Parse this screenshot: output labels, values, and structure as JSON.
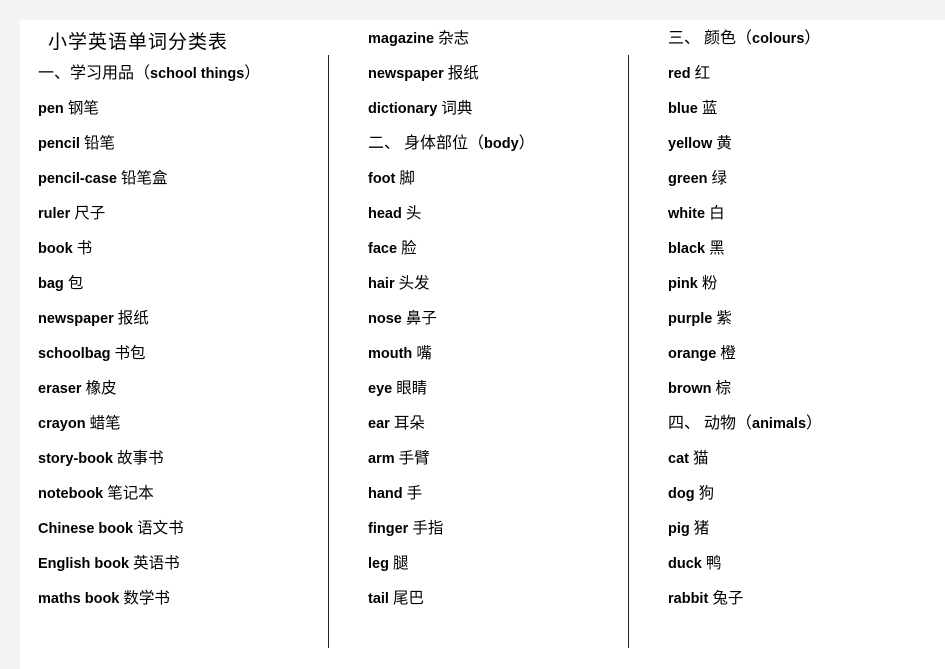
{
  "document": {
    "title": "小学英语单词分类表",
    "background_color": "#ffffff",
    "margin_color": "#f3f3f3",
    "rule_color": "#222222"
  },
  "columns": [
    {
      "id": "column-1",
      "blocks": [
        {
          "kind": "title",
          "text": "小学英语单词分类表"
        },
        {
          "kind": "heading",
          "zh": "一、学习用品（",
          "en": "school  things",
          "zh_close": "）"
        },
        {
          "kind": "entry",
          "en": "pen",
          "zh": "钢笔"
        },
        {
          "kind": "entry",
          "en": "pencil",
          "zh": "铅笔"
        },
        {
          "kind": "entry",
          "en": "pencil-case",
          "zh": "铅笔盒"
        },
        {
          "kind": "entry",
          "en": "ruler",
          "zh": "尺子"
        },
        {
          "kind": "entry",
          "en": "book",
          "zh": " 书"
        },
        {
          "kind": "entry",
          "en": "bag",
          "zh": " 包"
        },
        {
          "kind": "entry",
          "en": "newspaper",
          "zh": "报纸"
        },
        {
          "kind": "entry",
          "en": "schoolbag",
          "zh": "书包"
        },
        {
          "kind": "entry",
          "en": "eraser",
          "zh": "橡皮"
        },
        {
          "kind": "entry",
          "en": "crayon",
          "zh": "蜡笔"
        },
        {
          "kind": "entry",
          "en": "story-book",
          "zh": "故事书"
        },
        {
          "kind": "entry",
          "en": "notebook",
          "zh": "笔记本"
        },
        {
          "kind": "entry",
          "en": "Chinese  book",
          "zh": "语文书"
        },
        {
          "kind": "entry",
          "en": "English  book",
          "zh": "英语书"
        },
        {
          "kind": "entry",
          "en": "maths  book",
          "zh": "数学书"
        }
      ]
    },
    {
      "id": "column-2",
      "blocks": [
        {
          "kind": "entry",
          "en": "magazine",
          "zh": "杂志"
        },
        {
          "kind": "entry",
          "en": "newspaper",
          "zh": " 报纸"
        },
        {
          "kind": "entry",
          "en": "dictionary",
          "zh": "词典"
        },
        {
          "kind": "heading",
          "zh": "二、 身体部位（",
          "en": "body",
          "zh_close": "）"
        },
        {
          "kind": "entry",
          "en": "foot",
          "zh": "脚"
        },
        {
          "kind": "entry",
          "en": "head",
          "zh": "头"
        },
        {
          "kind": "entry",
          "en": "face",
          "zh": "脸"
        },
        {
          "kind": "entry",
          "en": "hair",
          "zh": "头发"
        },
        {
          "kind": "entry",
          "en": "nose",
          "zh": "鼻子"
        },
        {
          "kind": "entry",
          "en": "mouth",
          "zh": "嘴"
        },
        {
          "kind": "entry",
          "en": "eye",
          "zh": "眼睛"
        },
        {
          "kind": "entry",
          "en": "ear",
          "zh": "耳朵"
        },
        {
          "kind": "entry",
          "en": "arm",
          "zh": "手臂"
        },
        {
          "kind": "entry",
          "en": "hand",
          "zh": "手"
        },
        {
          "kind": "entry",
          "en": "finger",
          "zh": "手指"
        },
        {
          "kind": "entry",
          "en": "leg",
          "zh": "腿"
        },
        {
          "kind": "entry",
          "en": "tail",
          "zh": "尾巴"
        }
      ]
    },
    {
      "id": "column-3",
      "blocks": [
        {
          "kind": "heading",
          "zh": "三、 颜色（",
          "en": "colours",
          "zh_close": "）"
        },
        {
          "kind": "entry",
          "en": "red",
          "zh": "红"
        },
        {
          "kind": "entry",
          "en": "blue",
          "zh": "蓝"
        },
        {
          "kind": "entry",
          "en": "yellow",
          "zh": "黄"
        },
        {
          "kind": "entry",
          "en": "green",
          "zh": "绿"
        },
        {
          "kind": "entry",
          "en": "white",
          "zh": "白"
        },
        {
          "kind": "entry",
          "en": "black",
          "zh": "黑"
        },
        {
          "kind": "entry",
          "en": "pink",
          "zh": "粉"
        },
        {
          "kind": "entry",
          "en": "purple",
          "zh": "紫"
        },
        {
          "kind": "entry",
          "en": "orange",
          "zh": "橙"
        },
        {
          "kind": "entry",
          "en": "brown",
          "zh": "棕"
        },
        {
          "kind": "heading",
          "zh": "四、 动物（",
          "en": "animals",
          "zh_close": "）"
        },
        {
          "kind": "entry",
          "en": "cat",
          "zh": "猫"
        },
        {
          "kind": "entry",
          "en": "dog",
          "zh": "狗"
        },
        {
          "kind": "entry",
          "en": "pig",
          "zh": "猪"
        },
        {
          "kind": "entry",
          "en": "duck",
          "zh": "鸭"
        },
        {
          "kind": "entry",
          "en": "rabbit",
          "zh": "兔子"
        }
      ]
    }
  ]
}
